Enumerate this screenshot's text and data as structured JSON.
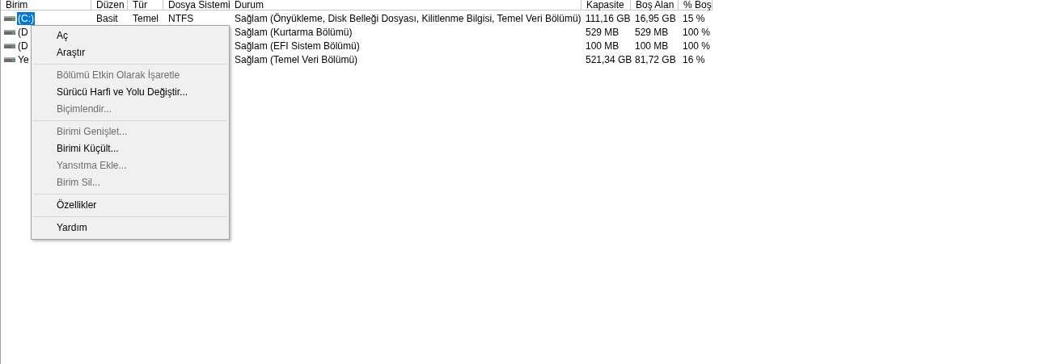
{
  "table": {
    "columns": [
      "Birim",
      "Düzen",
      "Tür",
      "Dosya Sistemi",
      "Durum",
      "Kapasite",
      "Boş Alan",
      "% Boş"
    ],
    "rows": [
      {
        "selected": true,
        "cells": [
          "(C:)",
          "Basit",
          "Temel",
          "NTFS",
          "Sağlam (Önyükleme, Disk Belleği Dosyası, Kilitlenme Bilgisi, Temel Veri Bölümü)",
          "111,16 GB",
          "16,95 GB",
          "15 %"
        ]
      },
      {
        "selected": false,
        "cells": [
          "(D",
          "",
          "",
          "",
          "Sağlam (Kurtarma Bölümü)",
          "529 MB",
          "529 MB",
          "100 %"
        ]
      },
      {
        "selected": false,
        "cells": [
          "(D",
          "",
          "",
          "",
          "Sağlam (EFI Sistem Bölümü)",
          "100 MB",
          "100 MB",
          "100 %"
        ]
      },
      {
        "selected": false,
        "cells": [
          "Ye",
          "",
          "",
          "",
          "Sağlam (Temel Veri Bölümü)",
          "521,34 GB",
          "81,72 GB",
          "16 %"
        ]
      }
    ]
  },
  "context_menu": {
    "items": [
      {
        "kind": "item",
        "label": "Aç",
        "disabled": false
      },
      {
        "kind": "item",
        "label": "Araştır",
        "disabled": false
      },
      {
        "kind": "separator"
      },
      {
        "kind": "item",
        "label": "Bölümü Etkin Olarak İşaretle",
        "disabled": true
      },
      {
        "kind": "item",
        "label": "Sürücü Harfi ve Yolu Değiştir...",
        "disabled": false
      },
      {
        "kind": "item",
        "label": "Biçimlendir...",
        "disabled": true
      },
      {
        "kind": "separator"
      },
      {
        "kind": "item",
        "label": "Birimi Genişlet...",
        "disabled": true
      },
      {
        "kind": "item",
        "label": "Birimi Küçült...",
        "disabled": false
      },
      {
        "kind": "item",
        "label": "Yansıtma Ekle...",
        "disabled": true
      },
      {
        "kind": "item",
        "label": "Birim Sil...",
        "disabled": true
      },
      {
        "kind": "separator"
      },
      {
        "kind": "item",
        "label": "Özellikler",
        "disabled": false
      },
      {
        "kind": "separator"
      },
      {
        "kind": "item",
        "label": "Yardım",
        "disabled": false
      }
    ]
  }
}
